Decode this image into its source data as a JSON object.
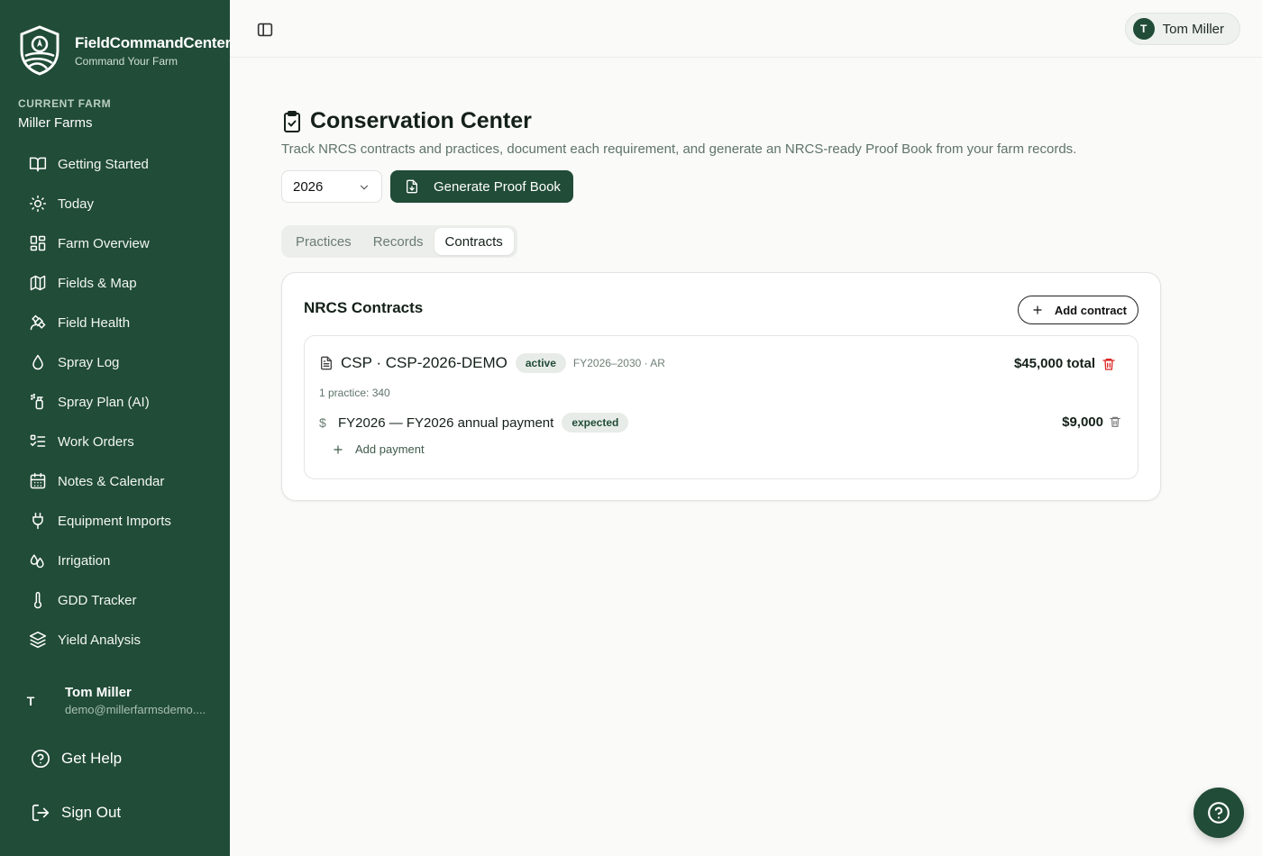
{
  "brand": {
    "name": "FieldCommandCenter",
    "tagline": "Command Your Farm"
  },
  "farm": {
    "label": "CURRENT FARM",
    "name": "Miller Farms"
  },
  "nav": {
    "items": [
      {
        "label": "Getting Started",
        "icon": "book-open-icon"
      },
      {
        "label": "Today",
        "icon": "sun-icon"
      },
      {
        "label": "Farm Overview",
        "icon": "dashboard-icon"
      },
      {
        "label": "Fields & Map",
        "icon": "map-icon"
      },
      {
        "label": "Field Health",
        "icon": "satellite-icon"
      },
      {
        "label": "Spray Log",
        "icon": "droplet-icon"
      },
      {
        "label": "Spray Plan (AI)",
        "icon": "spray-bottle-icon"
      },
      {
        "label": "Work Orders",
        "icon": "list-todo-icon"
      },
      {
        "label": "Notes & Calendar",
        "icon": "calendar-icon"
      },
      {
        "label": "Equipment Imports",
        "icon": "plug-icon"
      },
      {
        "label": "Irrigation",
        "icon": "droplets-icon"
      },
      {
        "label": "GDD Tracker",
        "icon": "thermometer-icon"
      },
      {
        "label": "Yield Analysis",
        "icon": "layers-icon"
      }
    ]
  },
  "sidebar_user": {
    "initial": "T",
    "name": "Tom Miller",
    "email": "demo@millerfarmsdemo...."
  },
  "sidebar_links": {
    "help": "Get Help",
    "signout": "Sign Out"
  },
  "header": {
    "user_initial": "T",
    "user_name": "Tom Miller"
  },
  "page": {
    "title": "Conservation Center",
    "subtitle": "Track NRCS contracts and practices, document each requirement, and generate an NRCS-ready Proof Book from your farm records.",
    "year": "2026",
    "generate_label": "Generate Proof Book"
  },
  "tabs": [
    {
      "label": "Practices",
      "active": false
    },
    {
      "label": "Records",
      "active": false
    },
    {
      "label": "Contracts",
      "active": true
    }
  ],
  "contracts_card": {
    "title": "NRCS Contracts",
    "add_label": "Add contract",
    "contract": {
      "name": "CSP · CSP-2026-DEMO",
      "status": "active",
      "meta": "FY2026–2030 · AR",
      "total": "$45,000 total",
      "practices": "1 practice: 340",
      "payment": {
        "label": "FY2026 — FY2026 annual payment",
        "status": "expected",
        "amount": "$9,000"
      },
      "add_payment_label": "Add payment"
    }
  },
  "colors": {
    "primary": "#214c37",
    "danger": "#dc2626",
    "badge_bg": "#e8ece8"
  }
}
